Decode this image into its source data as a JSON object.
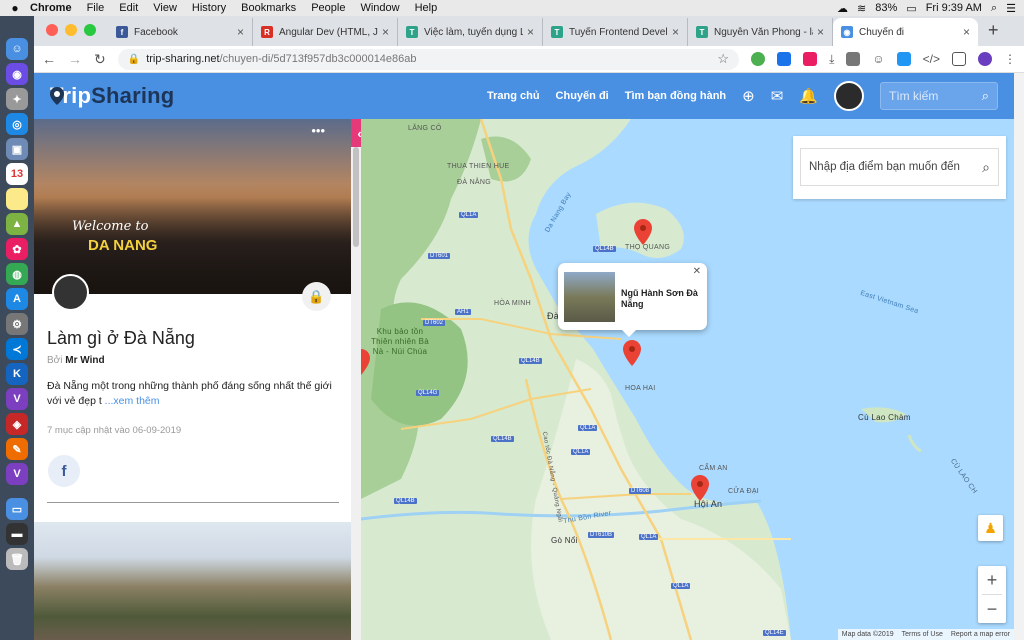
{
  "macbar": {
    "app": "Chrome",
    "menus": [
      "File",
      "Edit",
      "View",
      "History",
      "Bookmarks",
      "People",
      "Window",
      "Help"
    ],
    "battery": "83%",
    "clock": "Fri 9:39 AM"
  },
  "browser": {
    "tabs": [
      {
        "title": "Facebook",
        "fav": "f",
        "color": "#3b5998"
      },
      {
        "title": "Angular Dev (HTML, Java...",
        "fav": "R",
        "color": "#d93025"
      },
      {
        "title": "Việc làm, tuyển dụng Lập...",
        "fav": "T",
        "color": "#2fa38a"
      },
      {
        "title": "Tuyển Frontend Developer...",
        "fav": "T",
        "color": "#2fa38a"
      },
      {
        "title": "Nguyễn Văn Phong - lập...",
        "fav": "T",
        "color": "#2fa38a"
      },
      {
        "title": "Chuyến đi",
        "fav": "◉",
        "color": "#4a90e2",
        "active": true
      }
    ],
    "url_host": "trip-sharing.net",
    "url_path": "/chuyen-di/5d713f957db3c000014e86ab"
  },
  "site": {
    "logo_a": "Trip",
    "logo_b": "Sharing",
    "nav": [
      "Trang chủ",
      "Chuyến đi",
      "Tìm bạn đồng hành"
    ],
    "search_placeholder": "Tìm kiếm"
  },
  "trip": {
    "cover_text_1": "Welcome to",
    "cover_text_2": "DA NANG",
    "title": "Làm gì ở Đà Nẵng",
    "by_label": "Bởi",
    "author": "Mr Wind",
    "description": "Đà Nẵng một trong những thành phố đáng sống nhất thế giới với vẻ đẹp t",
    "read_more": "...xem thêm",
    "meta": "7 mục cập nhật vào 06-09-2019"
  },
  "map": {
    "search_placeholder": "Nhập địa điểm bạn muốn đến",
    "popup_title": "Ngũ Hành Sơn Đà Nẵng",
    "labels": {
      "lang_co": "LĂNG CÔ",
      "thua_thien_hue": "THUA THIEN HUE",
      "da_nang_prov": "ĐÀ NẴNG",
      "da_nang_bay": "Da Nang Bay",
      "tho_quang": "THỌ QUANG",
      "hoa_minh": "HÒA MINH",
      "da": "Đà",
      "reserve": "Khu bảo tồn Thiên nhiên Bà Nà - Núi Chúa",
      "hoa_hai": "HOA HAI",
      "east_sea": "East Vietnam Sea",
      "cu_lao_cham": "Cù Lao Chàm",
      "cu_lao_ch": "CÙ LAO CH",
      "cam_an": "CẨM AN",
      "cua_dai": "CỬA ĐẠI",
      "hoi_an": "Hội An",
      "go_noi": "Gò Nổi",
      "thu_bon": "Thu Bồn River",
      "expressway": "Cao tốc Đà Nẵng - Quảng Ngãi"
    },
    "roads": [
      "QL1A",
      "DT601",
      "QL14B",
      "AH1",
      "DT602",
      "QL14B",
      "QL14G",
      "QL1A",
      "QL14B",
      "QL1A",
      "DT608",
      "QL14B",
      "DT610B",
      "QL1A",
      "QL1A",
      "QL14E"
    ],
    "footer": [
      "Map data ©2019",
      "Terms of Use",
      "Report a map error"
    ]
  }
}
